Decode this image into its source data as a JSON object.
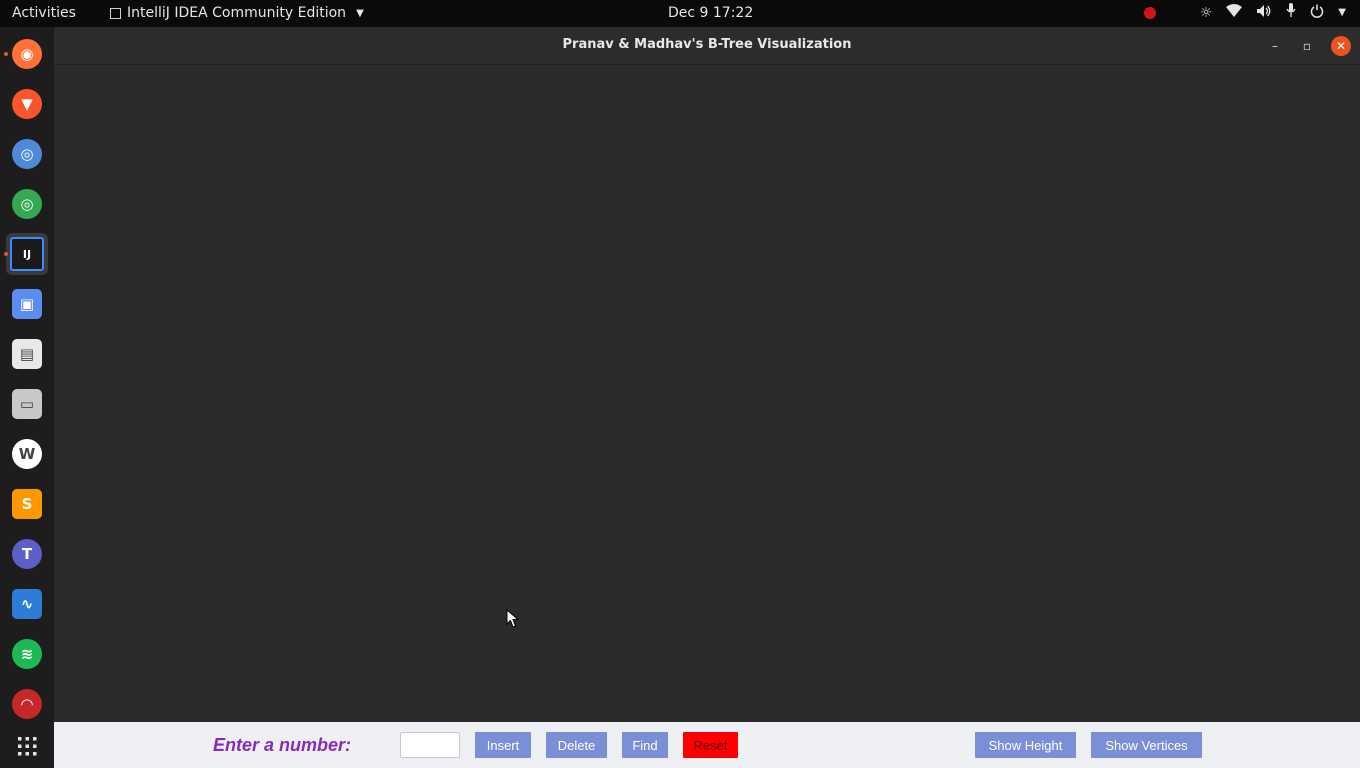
{
  "topbar": {
    "activities": "Activities",
    "app_name": "IntelliJ IDEA Community Edition",
    "clock": "Dec 9  17:22"
  },
  "dock": {
    "items": [
      {
        "icon": "firefox-icon",
        "color": "#ff7139",
        "running": true
      },
      {
        "icon": "brave-icon",
        "color": "#fb542b",
        "running": false
      },
      {
        "icon": "chromium-icon",
        "color": "#4f8ad9",
        "running": false
      },
      {
        "icon": "chrome-icon",
        "color": "#34a853",
        "running": false
      },
      {
        "icon": "intellij-icon",
        "color": "#1a1a1a",
        "running": true,
        "active": true
      },
      {
        "icon": "screenshot-icon",
        "color": "#5b8def",
        "running": false
      },
      {
        "icon": "office-icon",
        "color": "#e8e8e8",
        "running": false
      },
      {
        "icon": "files-icon",
        "color": "#c8c8c8",
        "running": false
      },
      {
        "icon": "wps-icon",
        "color": "#ffffff",
        "running": false
      },
      {
        "icon": "sublime-text-icon",
        "color": "#ff9800",
        "running": false
      },
      {
        "icon": "teams-icon",
        "color": "#5b5fc7",
        "running": false
      },
      {
        "icon": "system-monitor-icon",
        "color": "#2c7bd6",
        "running": false
      },
      {
        "icon": "spotify-icon",
        "color": "#1db954",
        "running": false
      },
      {
        "icon": "speedometer-icon",
        "color": "#c62828",
        "running": false
      }
    ]
  },
  "window": {
    "title": "Pranav & Madhav's B-Tree Visualization"
  },
  "controls": {
    "prompt": "Enter a number:",
    "input_value": "",
    "insert_label": "Insert",
    "delete_label": "Delete",
    "find_label": "Find",
    "reset_label": "Reset",
    "show_height_label": "Show Height",
    "show_vertices_label": "Show Vertices"
  }
}
